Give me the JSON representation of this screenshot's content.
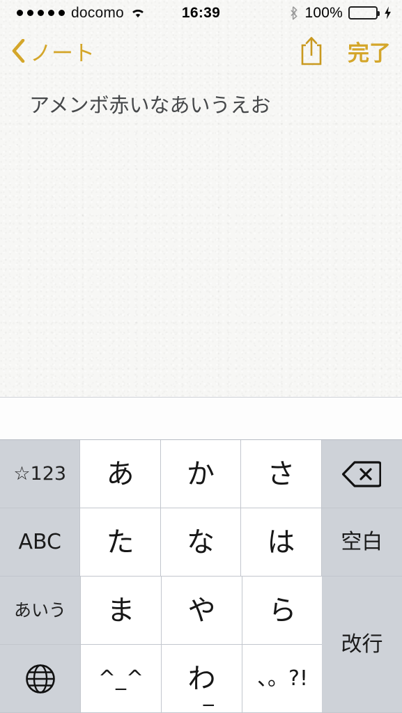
{
  "status_bar": {
    "signal_dots": 5,
    "carrier": "docomo",
    "wifi_icon": "wifi-icon",
    "time": "16:39",
    "bluetooth_icon": "bluetooth-icon",
    "battery_percent": "100%",
    "battery_level": 100,
    "charging_icon": "lightning-bolt-icon",
    "battery_color": "#4cd964"
  },
  "nav_bar": {
    "back_icon": "chevron-left-icon",
    "back_label": "ノート",
    "share_icon": "share-icon",
    "done_label": "完了",
    "accent_color": "#d4a62a"
  },
  "note": {
    "text": "アメンボ赤いなあいうえお",
    "add_button_icon": "plus-icon",
    "add_button_color": "#b9bdc3",
    "highlight_color": "#f6361a"
  },
  "keyboard": {
    "type": "japanese-kana-10key",
    "rows": [
      [
        {
          "label": "☆123",
          "name": "key-symbols-123",
          "style": "dark",
          "size": "small"
        },
        {
          "label": "あ",
          "name": "key-a",
          "style": "light",
          "size": "large"
        },
        {
          "label": "か",
          "name": "key-ka",
          "style": "light",
          "size": "large"
        },
        {
          "label": "さ",
          "name": "key-sa",
          "style": "light",
          "size": "large"
        },
        {
          "label": "",
          "name": "key-backspace",
          "style": "dark",
          "size": "icon",
          "icon": "backspace-icon"
        }
      ],
      [
        {
          "label": "ABC",
          "name": "key-abc",
          "style": "dark",
          "size": "medium"
        },
        {
          "label": "た",
          "name": "key-ta",
          "style": "light",
          "size": "large"
        },
        {
          "label": "な",
          "name": "key-na",
          "style": "light",
          "size": "large"
        },
        {
          "label": "は",
          "name": "key-ha",
          "style": "light",
          "size": "large"
        },
        {
          "label": "空白",
          "name": "key-space",
          "style": "dark",
          "size": "medium"
        }
      ],
      [
        {
          "label": "あいう",
          "name": "key-aiu",
          "style": "dark",
          "size": "tiny"
        },
        {
          "label": "ま",
          "name": "key-ma",
          "style": "light",
          "size": "large"
        },
        {
          "label": "や",
          "name": "key-ya",
          "style": "light",
          "size": "large"
        },
        {
          "label": "ら",
          "name": "key-ra",
          "style": "light",
          "size": "large"
        }
      ],
      [
        {
          "label": "",
          "name": "key-globe",
          "style": "dark",
          "size": "icon",
          "icon": "globe-icon"
        },
        {
          "label": "^_^",
          "name": "key-emoticon",
          "style": "light",
          "size": "medium"
        },
        {
          "label": "わ",
          "name": "key-wa",
          "style": "light",
          "size": "large",
          "sub": "_"
        },
        {
          "label": "、。?!",
          "name": "key-punctuation",
          "style": "light",
          "size": "punct"
        }
      ]
    ],
    "return_key": {
      "label": "改行",
      "name": "key-return",
      "style": "dark"
    }
  }
}
